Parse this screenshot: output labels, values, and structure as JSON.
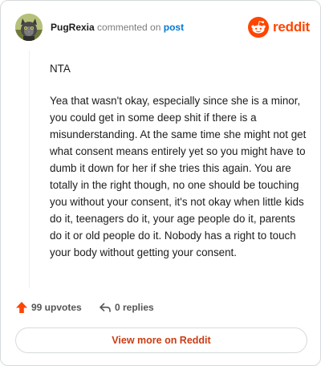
{
  "header": {
    "username": "PugRexia",
    "action_text": "commented on",
    "post_link": "post",
    "brand_name": "reddit",
    "brand_color": "#ff4500",
    "avatar_icon": "cat-avatar-icon",
    "logo_icon": "reddit-snoo-icon"
  },
  "comment": {
    "paragraphs": [
      "NTA",
      "Yea that wasn't okay, especially since she is a minor, you could get in some deep shit if there is a misunderstanding. At the same time she might not get what consent means entirely yet so you might have to dumb it down for her if she tries this again. You are totally in the right though, no one should be touching you without your consent, it's not okay when little kids do it, teenagers do it, your age people do it, parents do it or old people do it. Nobody has a right to touch your body without getting your consent."
    ]
  },
  "actions": {
    "upvotes_label": "99 upvotes",
    "replies_label": "0 replies",
    "upvote_icon": "upvote-arrow-icon",
    "reply_icon": "reply-arrow-icon",
    "upvote_color": "#ff4500"
  },
  "footer": {
    "view_more_label": "View more on Reddit",
    "button_text_color": "#c93d15"
  }
}
